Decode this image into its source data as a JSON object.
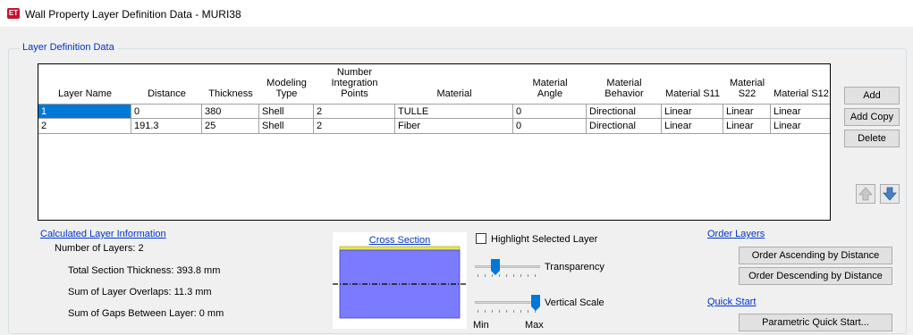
{
  "window": {
    "icon_text": "ET",
    "title": "Wall Property Layer Definition Data - MURI38"
  },
  "group_title": "Layer Definition Data",
  "table": {
    "headers": [
      "Layer Name",
      "Distance",
      "Thickness",
      "Modeling\nType",
      "Number\nIntegration\nPoints",
      "Material",
      "Material\nAngle",
      "Material\nBehavior",
      "Material S11",
      "Material S22",
      "Material S12"
    ],
    "rows": [
      [
        "1",
        "0",
        "380",
        "Shell",
        "2",
        "TULLE",
        "0",
        "Directional",
        "Linear",
        "Linear",
        "Linear"
      ],
      [
        "2",
        "191.3",
        "25",
        "Shell",
        "2",
        "Fiber",
        "0",
        "Directional",
        "Linear",
        "Linear",
        "Linear"
      ]
    ],
    "selected_row": 0
  },
  "buttons": {
    "add": "Add",
    "add_copy": "Add Copy",
    "delete": "Delete"
  },
  "calc": {
    "title": "Calculated Layer Information",
    "num_layers": "Number of Layers:  2",
    "total_thickness": "Total Section Thickness:  393.8 mm",
    "overlaps": "Sum of Layer Overlaps:  11.3 mm",
    "gaps": "Sum of Gaps Between Layer:  0 mm"
  },
  "cross_section": {
    "title": "Cross Section"
  },
  "controls": {
    "highlight_label": "Highlight Selected Layer",
    "highlight_checked": false,
    "transparency_label": "Transparency",
    "transparency_level": 0.28,
    "vertical_scale_label": "Vertical Scale",
    "vertical_scale_level": 1.0,
    "min_label": "Min",
    "max_label": "Max"
  },
  "order": {
    "title": "Order Layers",
    "asc": "Order Ascending by Distance",
    "desc": "Order Descending by Distance"
  },
  "quick_start": {
    "title": "Quick Start",
    "button": "Parametric Quick Start..."
  },
  "colors": {
    "selection": "#0078d7",
    "link": "#0033cc",
    "layer_main": "#7b7bff",
    "layer_top": "#e8e84a",
    "arrow": "#4a7ec2"
  }
}
